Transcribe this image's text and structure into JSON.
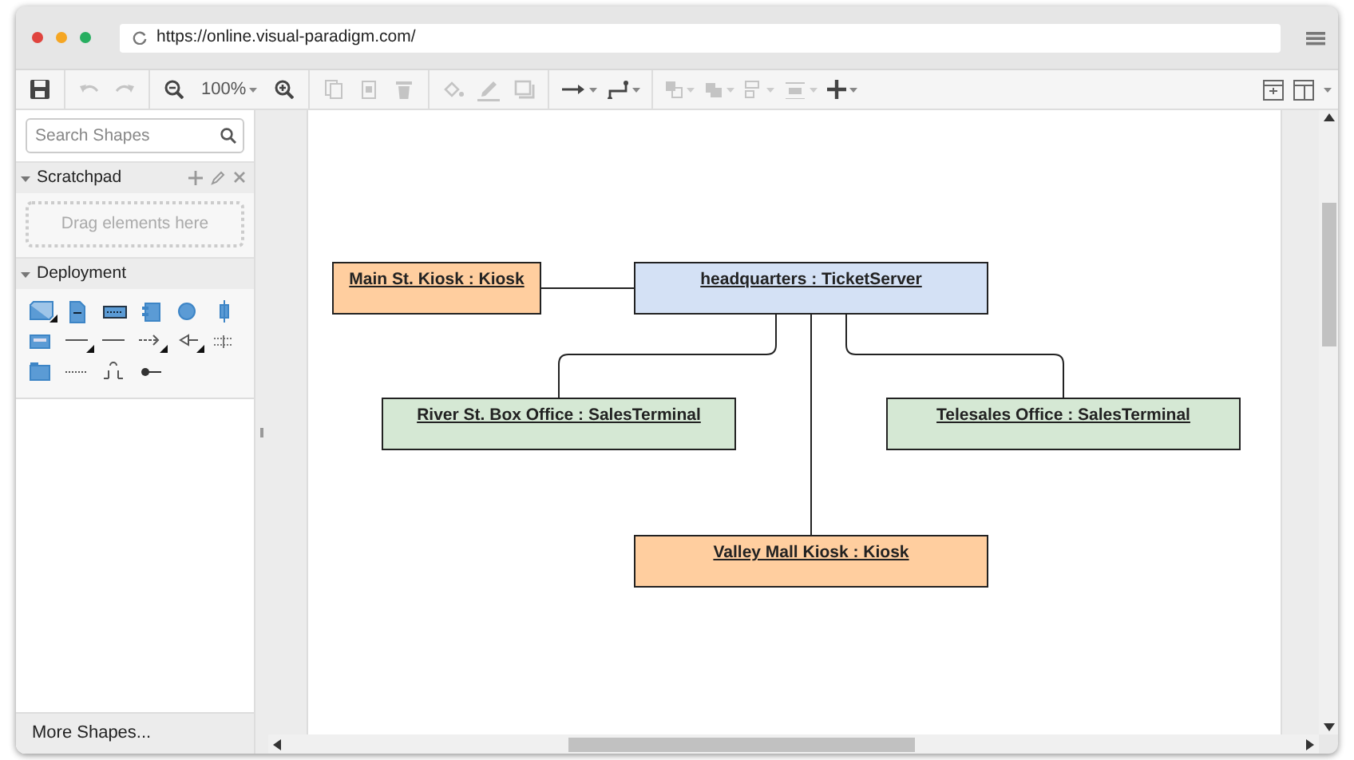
{
  "browser": {
    "url": "https://online.visual-paradigm.com/"
  },
  "toolbar": [
    {
      "kind": "save",
      "disabled": false
    },
    {
      "kind": "sep"
    },
    {
      "kind": "undo",
      "disabled": true
    },
    {
      "kind": "redo",
      "disabled": true
    },
    {
      "kind": "sep"
    },
    {
      "kind": "zoom-out",
      "disabled": false
    },
    {
      "kind": "zoom-level",
      "text": "100%",
      "disabled": false
    },
    {
      "kind": "zoom-in",
      "disabled": false
    },
    {
      "kind": "sep"
    },
    {
      "kind": "copy",
      "disabled": true
    },
    {
      "kind": "paste",
      "disabled": true
    },
    {
      "kind": "delete",
      "disabled": true
    },
    {
      "kind": "sep"
    },
    {
      "kind": "fill",
      "disabled": true
    },
    {
      "kind": "line-color",
      "disabled": true
    },
    {
      "kind": "shadow",
      "disabled": true
    },
    {
      "kind": "sep"
    },
    {
      "kind": "connector",
      "disabled": false
    },
    {
      "kind": "waypoint",
      "disabled": false
    },
    {
      "kind": "sep"
    },
    {
      "kind": "arrange",
      "disabled": true
    },
    {
      "kind": "layer",
      "disabled": true
    },
    {
      "kind": "align",
      "disabled": true
    },
    {
      "kind": "distribute",
      "disabled": true
    },
    {
      "kind": "insert",
      "disabled": false
    }
  ],
  "sidebar": {
    "search": {
      "placeholder": "Search Shapes"
    },
    "sections": [
      {
        "title": "Scratchpad",
        "expanded": true,
        "hint": "Drag elements here"
      },
      {
        "title": "Deployment",
        "expanded": true
      }
    ],
    "more": "More Shapes..."
  },
  "diagram": {
    "nodes": [
      {
        "label": "Main St. Kiosk : Kiosk",
        "color": "#ffce9f"
      },
      {
        "label": "headquarters : TicketServer",
        "color": "#d4e1f5"
      },
      {
        "label": "River St. Box Office : SalesTerminal",
        "color": "#d5e8d4"
      },
      {
        "label": "Telesales Office : SalesTerminal",
        "color": "#d5e8d4"
      },
      {
        "label": "Valley Mall Kiosk : Kiosk",
        "color": "#ffce9f"
      }
    ]
  }
}
